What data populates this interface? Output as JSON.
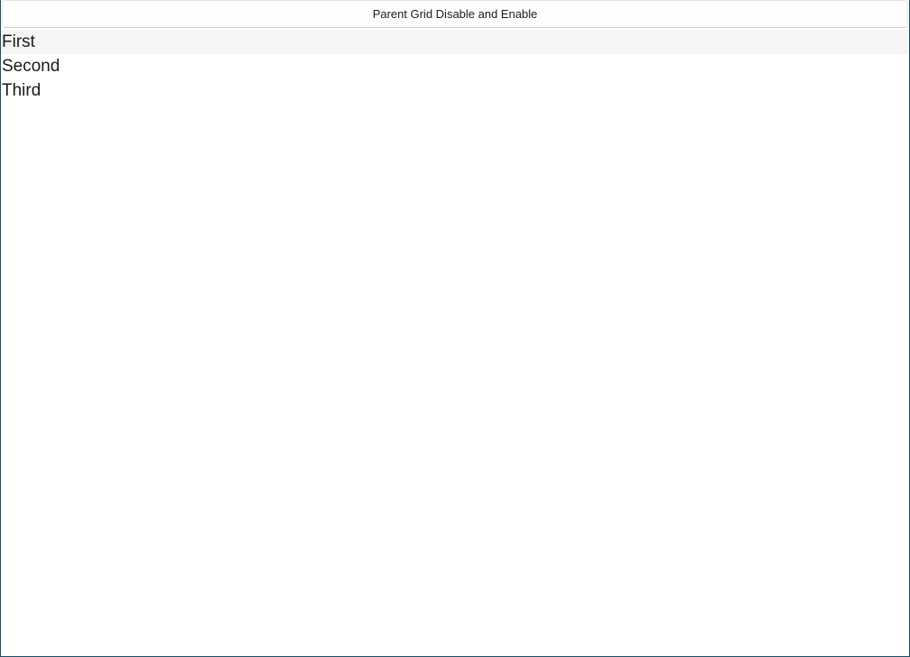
{
  "toolbar": {
    "button_label": "Parent Grid Disable and Enable"
  },
  "list": {
    "items": [
      {
        "label": "First"
      },
      {
        "label": "Second"
      },
      {
        "label": "Third"
      }
    ]
  }
}
